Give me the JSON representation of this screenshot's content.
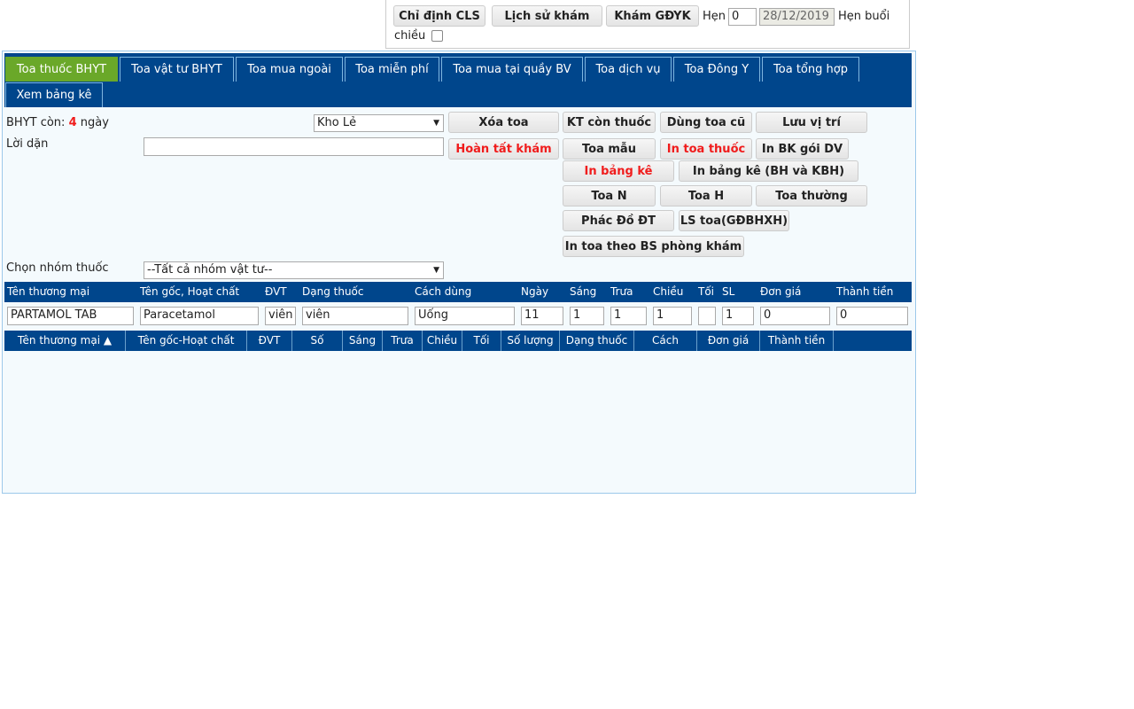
{
  "top": {
    "buttons": [
      "Chỉ định CLS",
      "Lịch sử khám",
      "Khám GĐYK"
    ],
    "hen_label": "Hẹn",
    "hen_value": "0",
    "date_value": "28/12/2019",
    "hen_buoi_label": "Hẹn buổi",
    "chieu_label": "chiều",
    "chieu_checked": false
  },
  "tabs": [
    "Toa thuốc BHYT",
    "Toa vật tư BHYT",
    "Toa mua ngoài",
    "Toa miễn phí",
    "Toa mua tại quầy BV",
    "Toa dịch vụ",
    "Toa Đông Y",
    "Toa tổng hợp",
    "Xem bảng kê"
  ],
  "active_tab": "Toa thuốc BHYT",
  "colors": {
    "tabbar": "#00468c",
    "active_tab": "#6aa829",
    "alert": "#f01c1c"
  },
  "form": {
    "bhyt_prefix": "BHYT còn:",
    "bhyt_days": "4",
    "bhyt_suffix": "ngày",
    "kho_value": "Kho Lẻ",
    "loi_dan_label": "Lời dặn",
    "loi_dan_value": "",
    "nhom_label": "Chọn nhóm thuốc",
    "nhom_value": "--Tất cả nhóm vật tư--"
  },
  "actions": {
    "xoa_toa": "Xóa toa",
    "kt_con_thuoc": "KT còn thuốc",
    "dung_toa_cu": "Dùng toa cũ",
    "luu_vi_tri": "Lưu vị trí",
    "hoan_tat_kham": "Hoàn tất khám",
    "toa_mau": "Toa mẫu",
    "in_toa_thuoc": "In toa thuốc",
    "in_bk_goi_dv": "In BK gói DV",
    "in_bang_ke": "In bảng kê",
    "in_bang_ke_bh_kbh": "In bảng kê (BH và KBH)",
    "toa_n": "Toa N",
    "toa_h": "Toa H",
    "toa_thuong": "Toa thường",
    "phac_do": "Phác Đồ ĐT",
    "ls_toa": "LS toa(GĐBHXH)",
    "in_toa_bs": "In toa theo BS phòng khám"
  },
  "entry": {
    "headers": [
      "Tên thương mại",
      "Tên gốc, Hoạt chất",
      "ĐVT",
      "Dạng thuốc",
      "Cách dùng",
      "Ngày",
      "Sáng",
      "Trưa",
      "Chiều",
      "Tối",
      "SL",
      "Đơn giá",
      "Thành tiền"
    ],
    "values": [
      "PARTAMOL TAB",
      "Paracetamol",
      "viên",
      "viên",
      "Uống",
      "11",
      "1",
      "1",
      "1",
      "",
      "1",
      "0",
      "0"
    ]
  },
  "grid": {
    "headers": [
      "Tên thương mại ▲",
      "Tên gốc-Hoạt chất",
      "ĐVT",
      "Số",
      "Sáng",
      "Trưa",
      "Chiều",
      "Tối",
      "Số lượng",
      "Dạng thuốc",
      "Cách",
      "Đơn giá",
      "Thành tiền",
      ""
    ],
    "rows": []
  }
}
